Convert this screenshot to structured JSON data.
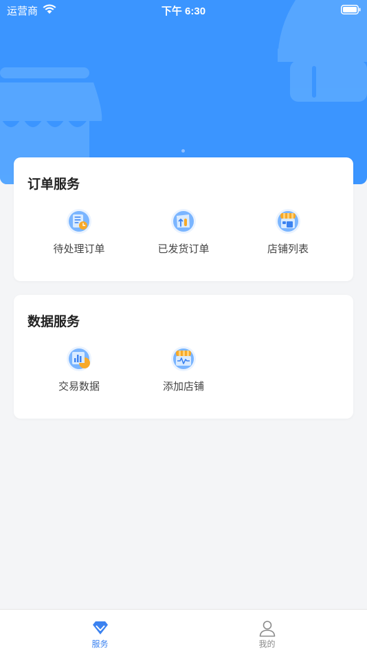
{
  "status_bar": {
    "carrier": "运营商",
    "time": "下午 6:30",
    "wifi_icon": "wifi-icon",
    "battery_icon": "battery-icon"
  },
  "colors": {
    "primary": "#3b95ff",
    "tab_active": "#3b82f0",
    "tab_inactive": "#8a8a8a"
  },
  "order_service": {
    "title": "订单服务",
    "items": [
      {
        "label": "待处理订单",
        "icon": "pending-orders-icon"
      },
      {
        "label": "已发货订单",
        "icon": "shipped-orders-icon"
      },
      {
        "label": "店铺列表",
        "icon": "store-list-icon"
      }
    ]
  },
  "data_service": {
    "title": "数据服务",
    "items": [
      {
        "label": "交易数据",
        "icon": "transaction-data-icon"
      },
      {
        "label": "添加店铺",
        "icon": "add-store-icon"
      }
    ]
  },
  "tabbar": {
    "tabs": [
      {
        "label": "服务",
        "icon": "diamond-icon",
        "active": true
      },
      {
        "label": "我的",
        "icon": "user-icon",
        "active": false
      }
    ]
  }
}
